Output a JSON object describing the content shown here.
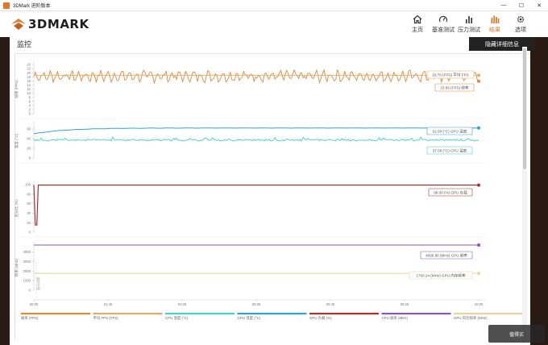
{
  "window": {
    "title": "3DMark 进阶版本"
  },
  "header": {
    "brand": "3DMARK"
  },
  "nav": [
    {
      "id": "home",
      "label": "主页",
      "icon": "home-icon"
    },
    {
      "id": "benchmark",
      "label": "基准测试",
      "icon": "gauge-icon"
    },
    {
      "id": "stress",
      "label": "压力测试",
      "icon": "bars-icon"
    },
    {
      "id": "results",
      "label": "结果",
      "icon": "results-icon",
      "active": true
    },
    {
      "id": "options",
      "label": "选项",
      "icon": "gear-icon"
    }
  ],
  "page": {
    "title": "监控",
    "hide_button": "隐藏详细信息"
  },
  "watermark": "值得买",
  "colors": {
    "accent": "#e07a2a",
    "fps": "#e08a3c",
    "avg_fps": "#e9a868",
    "cpu_temp": "#3fd4c4",
    "gpu_temp": "#2aa6d8",
    "gpu_load": "#b0302a",
    "cpu_clock": "#8a55c0",
    "gpu_mem_clock": "#e8d49a"
  },
  "chart_data": {
    "type": "line",
    "x_ticks": [
      "00:00",
      "01:40",
      "03:20",
      "05:00",
      "06:40",
      "08:20",
      "10:00"
    ],
    "panels": [
      {
        "id": "fps",
        "ylabel": "帧率 (FPS)",
        "ylim": [
          0,
          24
        ],
        "yticks": [
          "0",
          "2",
          "4",
          "6",
          "8",
          "10",
          "12",
          "14",
          "16",
          "18",
          "20",
          "22",
          "24"
        ],
        "series": [
          {
            "name": "帧率 (FPS)",
            "mean": 18.3,
            "amplitude": 2.6
          },
          {
            "name": "平均 FPS (FPS)",
            "value": 18.76
          }
        ],
        "callouts": [
          "18.76 (FPS) 平均 FPS",
          "15.85 (FPS) 帧率"
        ]
      },
      {
        "id": "temp",
        "ylabel": "温度 (°C)",
        "ylim": [
          0,
          70
        ],
        "yticks": [
          "0",
          "20",
          "40",
          "60"
        ],
        "series": [
          {
            "name": "GPU 温度 (°C)",
            "start": 50,
            "end": 62.0
          },
          {
            "name": "CPU 温度 (°C)",
            "mean": 37.0,
            "amplitude": 3.5
          }
        ],
        "callouts": [
          "62.00 (°C) GPU 温度",
          "37.00 (°C) CPU 温度"
        ]
      },
      {
        "id": "load",
        "ylabel": "百分比 (%)",
        "ylim": [
          0,
          100
        ],
        "yticks": [
          "0",
          "20",
          "40",
          "60",
          "80",
          "100"
        ],
        "series": [
          {
            "name": "GPU 负载 (%)",
            "value": 99.0
          }
        ],
        "callouts": [
          "99.00 (%) GPU 负载"
        ]
      },
      {
        "id": "clock",
        "ylabel": "频率 (MHz)",
        "ylim": [
          0,
          4700
        ],
        "yticks": [
          "0",
          "1000",
          "2000",
          "3000",
          "4000"
        ],
        "series": [
          {
            "name": "CPU 频率 (MHz)",
            "value": 4698.86
          },
          {
            "name": "GPU 内存频率 (MHz)",
            "value": 1750.24
          }
        ],
        "callouts": [
          "4698.86 (MHz) CPU 频率",
          "1750.24 (MHz) GPU 内存频率"
        ],
        "marker": "显示详情"
      }
    ],
    "legend": [
      {
        "label": "帧率 (FPS)",
        "color": "#e08a3c"
      },
      {
        "label": "平均 FPS (FPS)",
        "color": "#e9a868"
      },
      {
        "label": "CPU 温度 (°C)",
        "color": "#3fd4c4"
      },
      {
        "label": "GPU 温度 (°C)",
        "color": "#2aa6d8"
      },
      {
        "label": "GPU 负载 (%)",
        "color": "#b0302a"
      },
      {
        "label": "CPU 频率 (MHz)",
        "color": "#8a55c0"
      },
      {
        "label": "GPU 内存频率 (MHz)",
        "color": "#e8d49a"
      }
    ]
  }
}
